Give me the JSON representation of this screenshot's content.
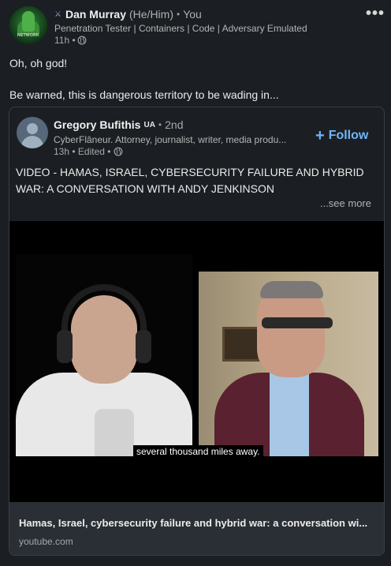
{
  "post": {
    "author": {
      "badge_icon": "crossed-swords-icon",
      "name": "Dan Murray",
      "pronouns": "(He/Him)",
      "separator": "•",
      "relation": "You",
      "headline": "Penetration Tester | Containers | Code | Adversary Emulated",
      "time": "11h •",
      "avatar_text": "NETWORK"
    },
    "more_label": "•••",
    "text_line1": "Oh, oh god!",
    "text_line2": "Be warned, this is dangerous territory to be wading in..."
  },
  "shared": {
    "author": {
      "name": "Gregory Bufithis",
      "flag": "UA",
      "separator": "•",
      "degree": "2nd",
      "headline": "CyberFlâneur. Attorney, journalist, writer, media produ...",
      "time": "13h • Edited •"
    },
    "follow_label": "Follow",
    "text": "VIDEO - HAMAS, ISRAEL, CYBERSECURITY FAILURE AND HYBRID WAR: A CONVERSATION WITH ANDY JENKINSON",
    "see_more": "...see more",
    "video": {
      "caption": "several thousand miles away."
    },
    "link": {
      "title": "Hamas, Israel, cybersecurity failure and hybrid war: a conversation wi...",
      "domain": "youtube.com"
    }
  },
  "colors": {
    "background": "#1b1f23",
    "accent": "#70b5f9",
    "link_bg": "#2a2f35"
  }
}
